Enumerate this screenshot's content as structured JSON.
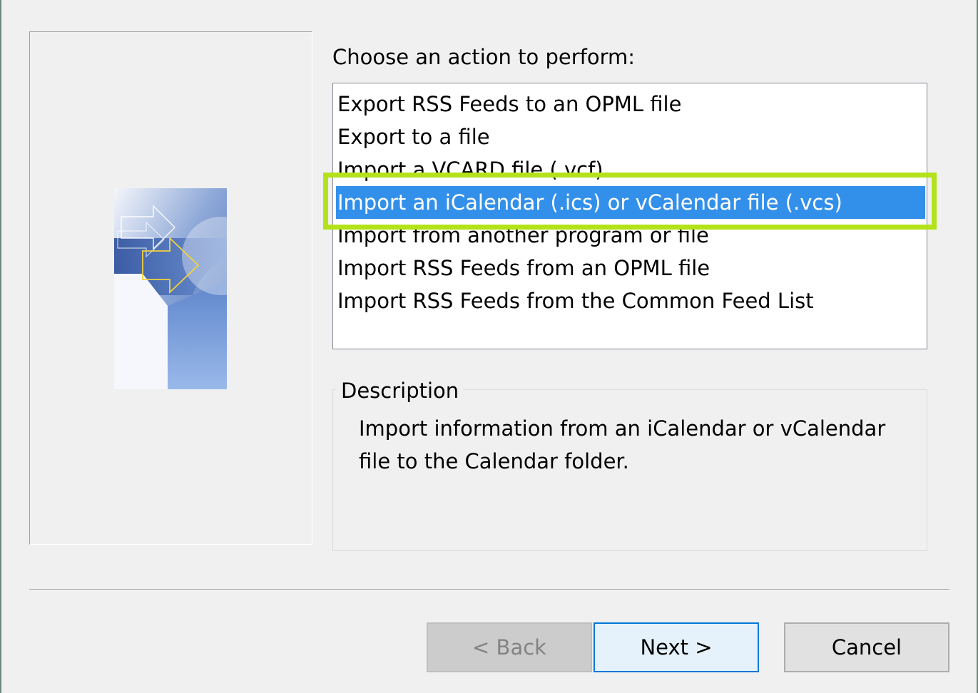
{
  "dialog": {
    "prompt_label": "Choose an action to perform:",
    "actions": [
      {
        "label": "Export RSS Feeds to an OPML file",
        "selected": false
      },
      {
        "label": "Export to a file",
        "selected": false
      },
      {
        "label": "Import a VCARD file (.vcf)",
        "selected": false
      },
      {
        "label": "Import an iCalendar (.ics) or vCalendar file (.vcs)",
        "selected": true
      },
      {
        "label": "Import from another program or file",
        "selected": false
      },
      {
        "label": "Import RSS Feeds from an OPML file",
        "selected": false
      },
      {
        "label": "Import RSS Feeds from the Common Feed List",
        "selected": false
      }
    ],
    "description": {
      "legend": "Description",
      "text": "Import information from an iCalendar or vCalendar file to the Calendar folder."
    },
    "buttons": {
      "back_label": "< Back",
      "next_label": "Next >",
      "cancel_label": "Cancel"
    }
  },
  "colors": {
    "selection_bg": "#3390ea",
    "highlight_outline": "#b4e21a",
    "dialog_bg": "#f0f0f0"
  },
  "icons": {
    "wizard_art": "import-export-wizard-art-icon"
  }
}
